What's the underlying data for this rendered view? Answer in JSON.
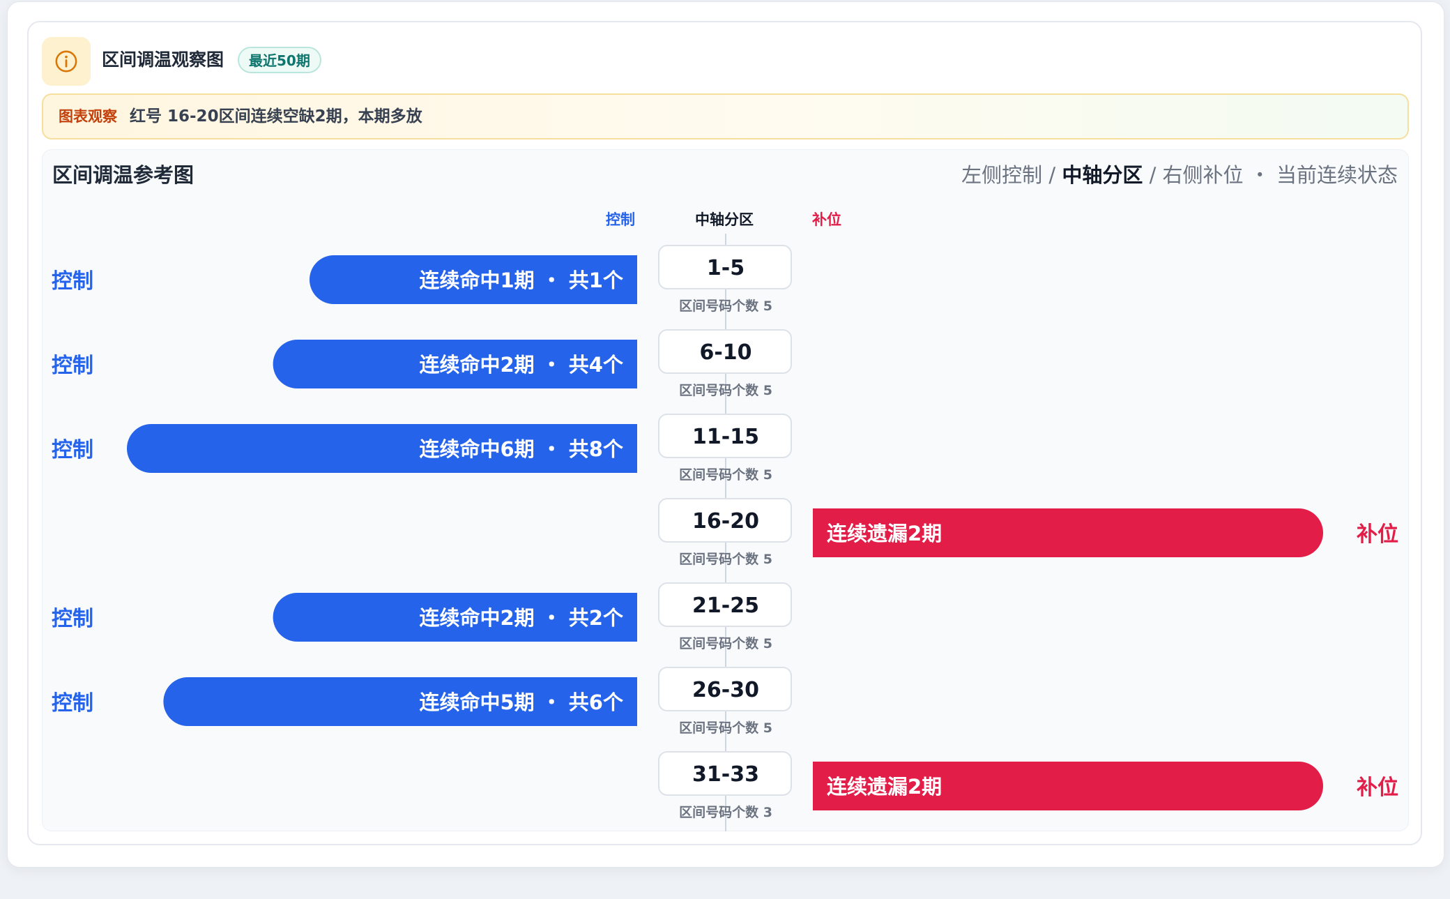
{
  "header": {
    "title": "区间调温观察图",
    "badge": "最近50期",
    "icon": "info-circle-icon"
  },
  "observation": {
    "label": "图表观察",
    "text": "红号 16-20区间连续空缺2期，本期多放"
  },
  "panel": {
    "title": "区间调温参考图",
    "legend_left": "左侧控制 /",
    "legend_mid": "中轴分区",
    "legend_right": "/ 右侧补位 ・ 当前连续状态"
  },
  "columns": {
    "left": "控制",
    "center": "中轴分区",
    "right": "补位"
  },
  "colors": {
    "control": "#2563eb",
    "fill": "#e11d48",
    "axis": "#cfd6df"
  },
  "chart_data": {
    "type": "bar",
    "categories": [
      "1-5",
      "6-10",
      "11-15",
      "16-20",
      "21-25",
      "26-30",
      "31-33"
    ],
    "counts": [
      5,
      5,
      5,
      5,
      5,
      5,
      3
    ],
    "count_label": "区间号码个数",
    "series": [
      {
        "name": "控制",
        "side": "left",
        "values": [
          1,
          2,
          6,
          null,
          2,
          5,
          null
        ],
        "labels": [
          "连续命中1期 ・ 共1个",
          "连续命中2期 ・ 共4个",
          "连续命中6期 ・ 共8个",
          null,
          "连续命中2期 ・ 共2个",
          "连续命中5期 ・ 共6个",
          null
        ]
      },
      {
        "name": "补位",
        "side": "right",
        "values": [
          null,
          null,
          null,
          2,
          null,
          null,
          2
        ],
        "labels": [
          null,
          null,
          null,
          "连续遗漏2期",
          null,
          null,
          "连续遗漏2期"
        ]
      }
    ]
  }
}
